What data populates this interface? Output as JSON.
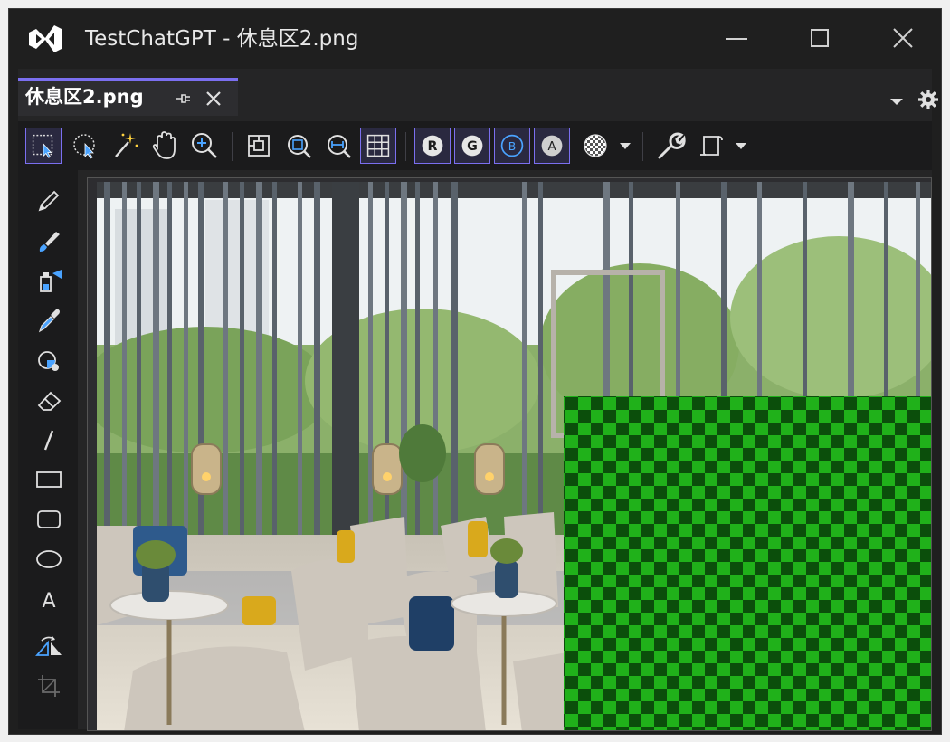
{
  "window": {
    "title": "TestChatGPT - 休息区2.png"
  },
  "titlebar_icons": {
    "app_logo": "visual-studio-logo-icon",
    "minimize": "minimize-icon",
    "maximize": "maximize-icon",
    "close": "close-icon"
  },
  "tab": {
    "label": "休息区2.png",
    "pin_icon": "pin-icon",
    "close_icon": "close-icon"
  },
  "toolbar": {
    "tools": [
      "rectangle-select-icon",
      "ellipse-select-icon",
      "magic-wand-icon",
      "pan-hand-icon",
      "zoom-in-icon",
      "zoom-actual-size-icon",
      "zoom-fit-icon",
      "zoom-width-icon",
      "grid-icon",
      "channel-r-icon",
      "channel-g-icon",
      "channel-b-icon",
      "channel-a-icon",
      "transparency-checker-icon",
      "wrench-icon",
      "properties-icon"
    ],
    "channels": [
      "R",
      "G",
      "B",
      "A"
    ]
  },
  "left_tools": [
    "pencil-icon",
    "brush-icon",
    "fill-bucket-icon",
    "eyedropper-icon",
    "color-replace-icon",
    "eraser-icon",
    "line-icon",
    "rectangle-icon",
    "rounded-rectangle-icon",
    "ellipse-icon",
    "text-tool-icon",
    "rotate-flip-icon",
    "crop-icon"
  ],
  "left_text_tool_label": "A",
  "colors": {
    "accent": "#7b6ff0",
    "checker_light": "#20b11a",
    "checker_dark": "#0b4e0b",
    "window_bg": "#1f1f1f"
  }
}
